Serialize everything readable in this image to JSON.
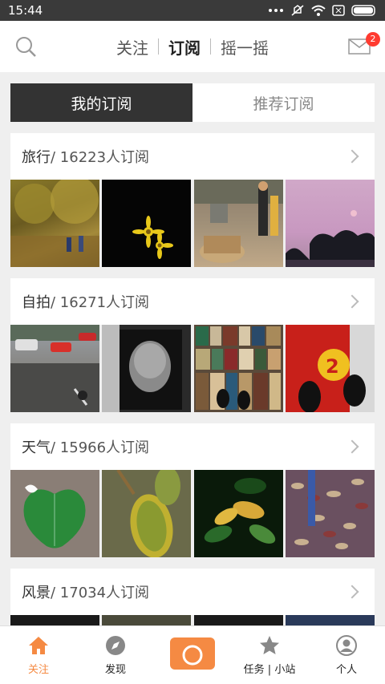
{
  "status": {
    "time": "15:44"
  },
  "topnav": {
    "tabs": [
      "关注",
      "订阅",
      "摇一摇"
    ],
    "active": "订阅",
    "badge": "2"
  },
  "segment": {
    "left": "我的订阅",
    "right": "推荐订阅"
  },
  "cards": [
    {
      "name": "旅行",
      "count": " / 16223人订阅"
    },
    {
      "name": "自拍",
      "count": " / 16271人订阅"
    },
    {
      "name": "天气",
      "count": " / 15966人订阅"
    },
    {
      "name": "风景",
      "count": " / 17034人订阅"
    }
  ],
  "bottomnav": [
    {
      "label": "关注",
      "icon": "home-icon"
    },
    {
      "label": "发现",
      "icon": "compass-icon"
    },
    {
      "label": "",
      "icon": "camera-icon"
    },
    {
      "label": "任务 | 小站",
      "icon": "star-icon"
    },
    {
      "label": "个人",
      "icon": "person-icon"
    }
  ],
  "colors": {
    "accent": "#f58a43",
    "dark": "#333333"
  }
}
